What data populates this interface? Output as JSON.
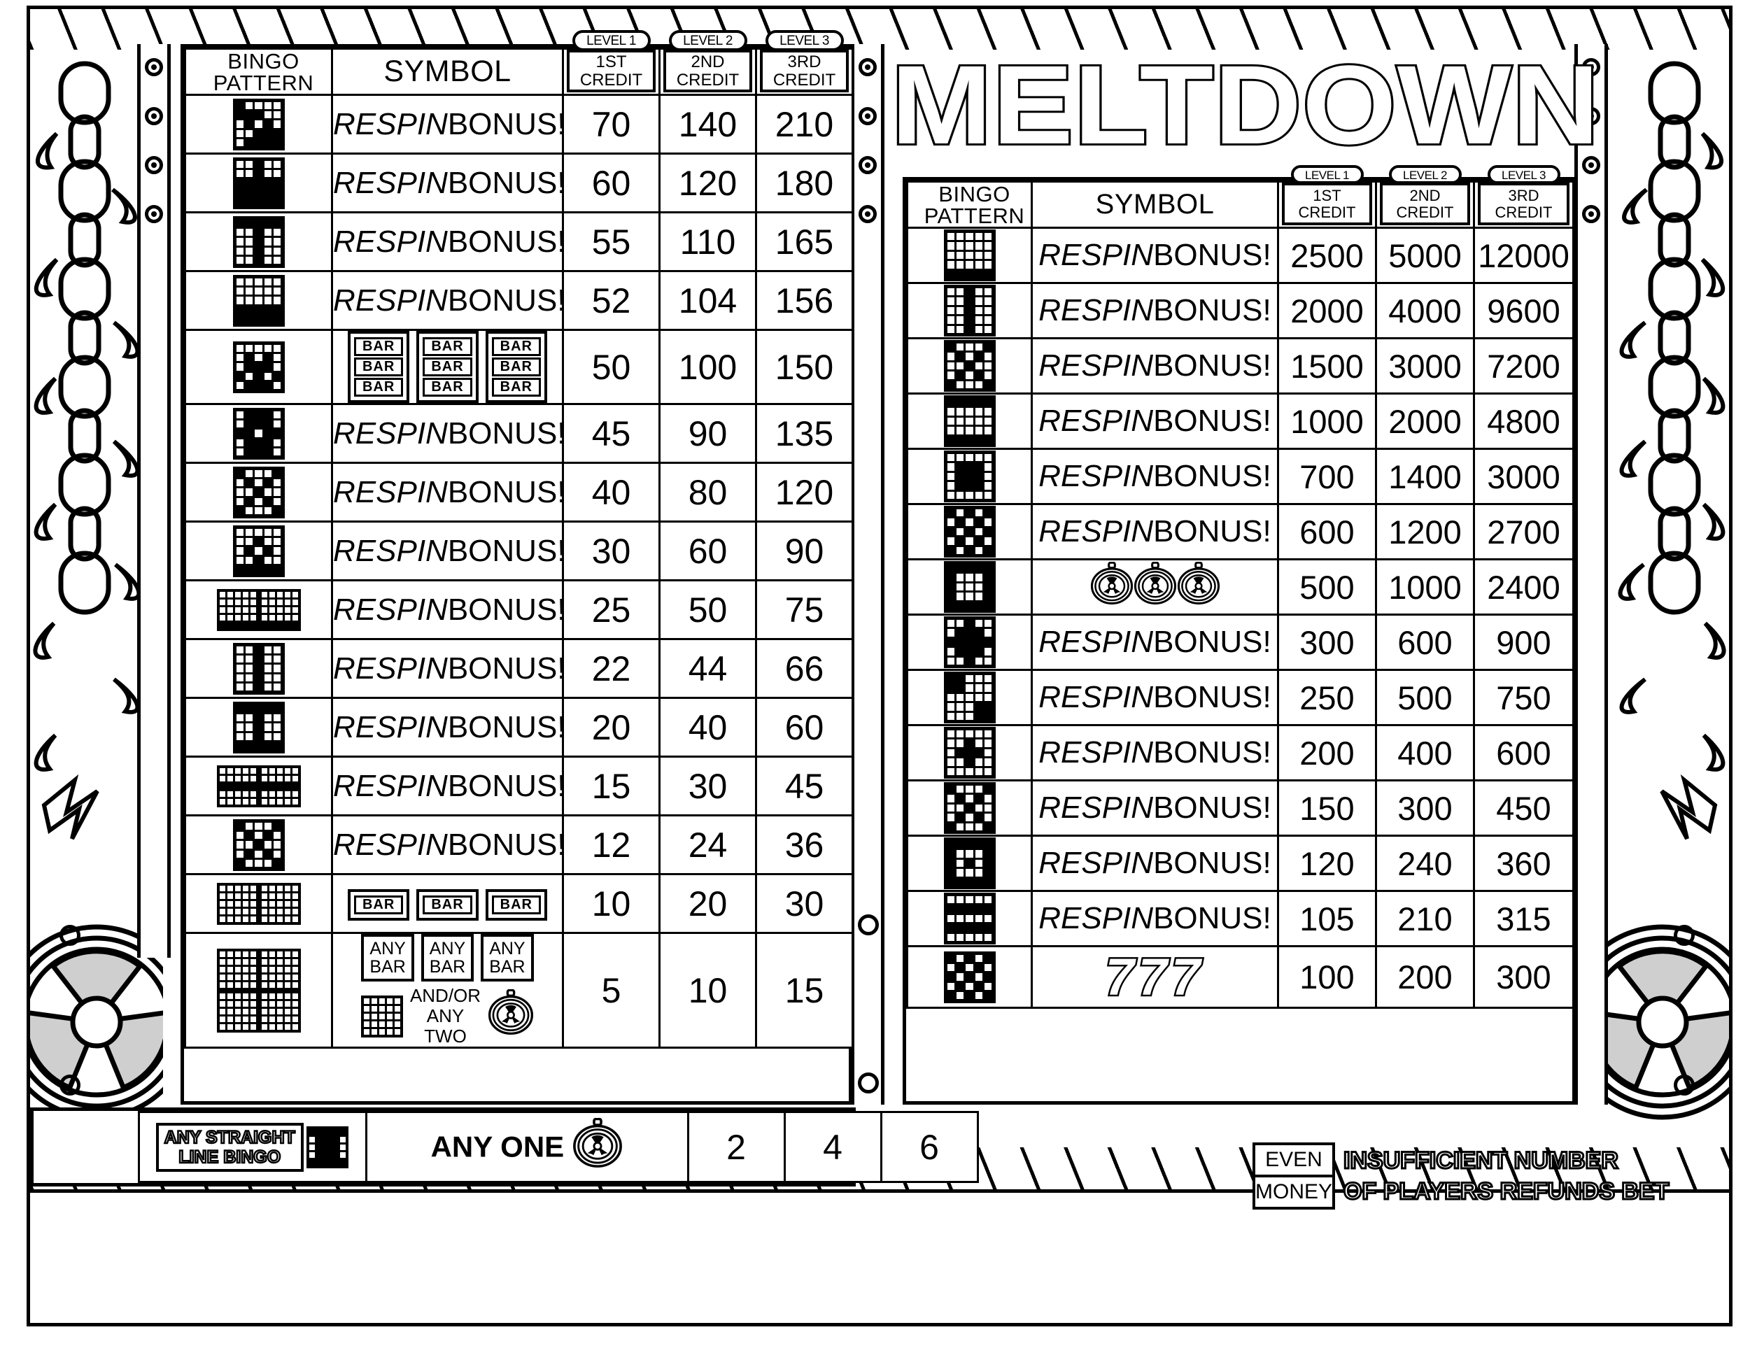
{
  "machine": {
    "title": "MELTDOWN",
    "even_money_line1": "EVEN",
    "even_money_line2": "MONEY",
    "insufficient_line1": "INSUFFICIENT NUMBER",
    "insufficient_line2": "OF PLAYERS REFUNDS BET"
  },
  "headers": {
    "bingo_pattern_line1": "BINGO",
    "bingo_pattern_line2": "PATTERN",
    "symbol": "SYMBOL",
    "levels": [
      {
        "pill": "LEVEL 1",
        "line1": "1ST",
        "line2": "CREDIT"
      },
      {
        "pill": "LEVEL 2",
        "line1": "2ND",
        "line2": "CREDIT"
      },
      {
        "pill": "LEVEL 3",
        "line1": "3RD",
        "line2": "CREDIT"
      }
    ]
  },
  "symbols": {
    "respin_italic": "RESPIN",
    "respin_roman": "BONUS!",
    "bar": "BAR",
    "any": "ANY",
    "andor": "AND/OR",
    "any_two_l1": "ANY",
    "any_two_l2": "TWO",
    "any_one": "ANY ONE",
    "seven": "7",
    "medallion_label": "MELTDOWN"
  },
  "left_table": {
    "rows": [
      {
        "symbol": "respin",
        "pattern": "p1",
        "c1": "70",
        "c2": "140",
        "c3": "210"
      },
      {
        "symbol": "respin",
        "pattern": "p2",
        "c1": "60",
        "c2": "120",
        "c3": "180"
      },
      {
        "symbol": "respin",
        "pattern": "p3",
        "c1": "55",
        "c2": "110",
        "c3": "165"
      },
      {
        "symbol": "respin",
        "pattern": "p4",
        "c1": "52",
        "c2": "104",
        "c3": "156"
      },
      {
        "symbol": "bar3",
        "pattern": "p5",
        "c1": "50",
        "c2": "100",
        "c3": "150"
      },
      {
        "symbol": "respin",
        "pattern": "p6",
        "c1": "45",
        "c2": "90",
        "c3": "135"
      },
      {
        "symbol": "respin",
        "pattern": "p7",
        "c1": "40",
        "c2": "80",
        "c3": "120"
      },
      {
        "symbol": "respin",
        "pattern": "p8",
        "c1": "30",
        "c2": "60",
        "c3": "90"
      },
      {
        "symbol": "respin",
        "pattern": "p9",
        "c1": "25",
        "c2": "50",
        "c3": "75"
      },
      {
        "symbol": "respin",
        "pattern": "p10",
        "c1": "22",
        "c2": "44",
        "c3": "66"
      },
      {
        "symbol": "respin",
        "pattern": "p11",
        "c1": "20",
        "c2": "40",
        "c3": "60"
      },
      {
        "symbol": "respin",
        "pattern": "p12",
        "c1": "15",
        "c2": "30",
        "c3": "45"
      },
      {
        "symbol": "respin",
        "pattern": "p13",
        "c1": "12",
        "c2": "24",
        "c3": "36"
      },
      {
        "symbol": "bar1",
        "pattern": "p14",
        "c1": "10",
        "c2": "20",
        "c3": "30"
      },
      {
        "symbol": "anybar",
        "pattern": "p15",
        "c1": "5",
        "c2": "10",
        "c3": "15"
      }
    ],
    "bottom_row": {
      "banner_line1": "ANY STRAIGHT",
      "banner_line2": "LINE BINGO",
      "symbol_label": "ANY ONE",
      "c1": "2",
      "c2": "4",
      "c3": "6"
    }
  },
  "right_table": {
    "rows": [
      {
        "symbol": "respin",
        "pattern": "q1",
        "c1": "2500",
        "c2": "5000",
        "c3": "12000"
      },
      {
        "symbol": "respin",
        "pattern": "q2",
        "c1": "2000",
        "c2": "4000",
        "c3": "9600"
      },
      {
        "symbol": "respin",
        "pattern": "q3",
        "c1": "1500",
        "c2": "3000",
        "c3": "7200"
      },
      {
        "symbol": "respin",
        "pattern": "q4",
        "c1": "1000",
        "c2": "2000",
        "c3": "4800"
      },
      {
        "symbol": "respin",
        "pattern": "q5",
        "c1": "700",
        "c2": "1400",
        "c3": "3000"
      },
      {
        "symbol": "respin",
        "pattern": "q6",
        "c1": "600",
        "c2": "1200",
        "c3": "2700"
      },
      {
        "symbol": "medal3",
        "pattern": "q7",
        "c1": "500",
        "c2": "1000",
        "c3": "2400"
      },
      {
        "symbol": "respin",
        "pattern": "q8",
        "c1": "300",
        "c2": "600",
        "c3": "900"
      },
      {
        "symbol": "respin",
        "pattern": "q9",
        "c1": "250",
        "c2": "500",
        "c3": "750"
      },
      {
        "symbol": "respin",
        "pattern": "q10",
        "c1": "200",
        "c2": "400",
        "c3": "600"
      },
      {
        "symbol": "respin",
        "pattern": "q11",
        "c1": "150",
        "c2": "300",
        "c3": "450"
      },
      {
        "symbol": "respin",
        "pattern": "q12",
        "c1": "120",
        "c2": "240",
        "c3": "360"
      },
      {
        "symbol": "respin",
        "pattern": "q13",
        "c1": "105",
        "c2": "210",
        "c3": "315"
      },
      {
        "symbol": "777",
        "pattern": "q14",
        "c1": "100",
        "c2": "200",
        "c3": "300"
      }
    ]
  },
  "patterns": {
    "p1": [
      "10000",
      "11100",
      "01010",
      "00111",
      "01111"
    ],
    "p2": [
      "00100",
      "00100",
      "11111",
      "11111",
      "11111"
    ],
    "p3": [
      "11111",
      "00100",
      "00100",
      "00100",
      "00100"
    ],
    "p4": [
      "00000",
      "00000",
      "00000",
      "11111",
      "11111"
    ],
    "p5": [
      "00000",
      "01010",
      "01110",
      "10101",
      "01110"
    ],
    "p6": [
      "01110",
      "01110",
      "11011",
      "01110",
      "01110"
    ],
    "p7": [
      "10001",
      "01010",
      "00100",
      "01010",
      "10001"
    ],
    "p8": [
      "00000",
      "00100",
      "01010",
      "00100",
      "11111"
    ],
    "p9": [
      "00000",
      "00000",
      "00000",
      "00000",
      "11111"
    ],
    "p10": [
      "00100",
      "00100",
      "00100",
      "00100",
      "00100"
    ],
    "p11": [
      "11111",
      "00100",
      "00100",
      "00100",
      "11111"
    ],
    "p12": [
      "00000",
      "00000",
      "11111",
      "00000",
      "00000"
    ],
    "p13": [
      "10001",
      "01010",
      "00100",
      "01010",
      "10001"
    ],
    "p14": [
      "00000",
      "00000",
      "00000",
      "00000",
      "00000"
    ],
    "p15": [
      "00000",
      "00000",
      "00000",
      "00000",
      "00000"
    ],
    "q1": [
      "00000",
      "00000",
      "00000",
      "00000",
      "11111"
    ],
    "q2": [
      "00100",
      "00100",
      "00100",
      "00100",
      "00100"
    ],
    "q3": [
      "10001",
      "01010",
      "00100",
      "01010",
      "10001"
    ],
    "q4": [
      "11111",
      "00000",
      "00000",
      "00000",
      "11111"
    ],
    "q5": [
      "00000",
      "01110",
      "01110",
      "01110",
      "00000"
    ],
    "q6": [
      "10101",
      "01010",
      "10101",
      "01010",
      "10101"
    ],
    "q7": [
      "11111",
      "10001",
      "10001",
      "10001",
      "11111"
    ],
    "q8": [
      "00100",
      "01110",
      "11111",
      "01110",
      "00100"
    ],
    "q9": [
      "11000",
      "11000",
      "00000",
      "00011",
      "00011"
    ],
    "q10": [
      "00000",
      "00100",
      "01110",
      "00100",
      "00000"
    ],
    "q11": [
      "10001",
      "01010",
      "00100",
      "01010",
      "10001"
    ],
    "q12": [
      "11111",
      "10001",
      "10101",
      "10001",
      "11111"
    ],
    "q13": [
      "00000",
      "11111",
      "00000",
      "11111",
      "00000"
    ],
    "q14": [
      "10101",
      "01010",
      "10101",
      "01010",
      "10101"
    ]
  }
}
